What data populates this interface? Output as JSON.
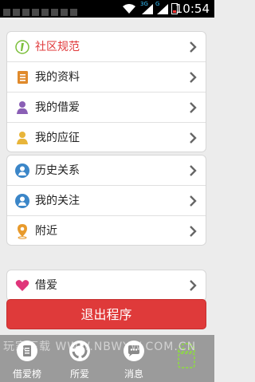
{
  "status_bar": {
    "time": "10:54",
    "network_3g": "3G",
    "network_g": "G"
  },
  "group1": [
    {
      "label": "社区规范",
      "icon": "community-rules-icon",
      "label_color": "#e0383a"
    },
    {
      "label": "我的资料",
      "icon": "profile-document-icon"
    },
    {
      "label": "我的借爱",
      "icon": "user-purple-icon"
    },
    {
      "label": "我的应征",
      "icon": "user-yellow-icon"
    }
  ],
  "group2": [
    {
      "label": "历史关系",
      "icon": "user-blue-icon"
    },
    {
      "label": "我的关注",
      "icon": "user-blue-icon"
    },
    {
      "label": "附近",
      "icon": "location-pin-icon"
    }
  ],
  "group3": [
    {
      "label": "借爱",
      "icon": "heart-icon"
    }
  ],
  "logout_label": "退出程序",
  "tabs": [
    {
      "label": "借爱榜",
      "icon": "leaderboard-icon"
    },
    {
      "label": "所爱",
      "icon": "loved-icon"
    },
    {
      "label": "消息",
      "icon": "message-icon"
    }
  ],
  "watermark": "玩家下载 WWW.NBWYW.COM.CN",
  "colors": {
    "accent_red": "#df3a3a",
    "tab_background": "#9b9b9b",
    "page_background": "#ececec"
  }
}
